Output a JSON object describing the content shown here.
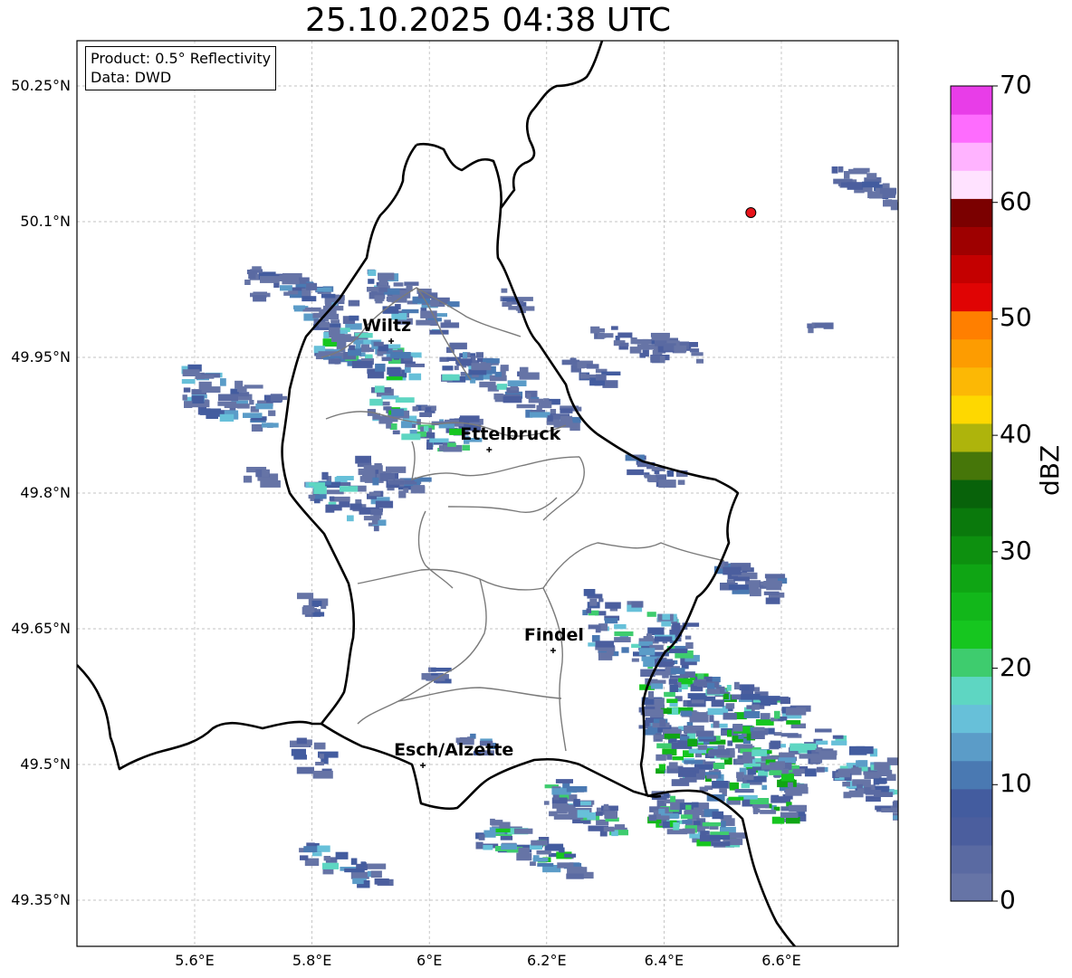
{
  "title": "25.10.2025 04:38 UTC",
  "info": {
    "product": "Product: 0.5° Reflectivity",
    "data": "Data: DWD"
  },
  "lat_labels": [
    "50.25°N",
    "50.1°N",
    "49.95°N",
    "49.8°N",
    "49.65°N",
    "49.5°N",
    "49.35°N"
  ],
  "lon_labels": [
    "5.6°E",
    "5.8°E",
    "6°E",
    "6.2°E",
    "6.4°E",
    "6.6°E"
  ],
  "cities": [
    {
      "name": "Wiltz",
      "lon": 5.935,
      "lat": 49.968
    },
    {
      "name": "Ettelbruck",
      "lon": 6.102,
      "lat": 49.848
    },
    {
      "name": "Findel",
      "lon": 6.211,
      "lat": 49.626
    },
    {
      "name": "Esch/Alzette",
      "lon": 5.989,
      "lat": 49.499
    }
  ],
  "radar_site": {
    "lon": 6.548,
    "lat": 50.11,
    "color": "#e8141b"
  },
  "colorbar": {
    "label": "dBZ",
    "ticks": [
      "0",
      "10",
      "20",
      "30",
      "40",
      "50",
      "60",
      "70"
    ],
    "colors": [
      "#6674a6",
      "#5a6aa2",
      "#4b5e9e",
      "#435c9f",
      "#4a79b2",
      "#5b9cc8",
      "#67c0d9",
      "#5ed6c2",
      "#3ecc6e",
      "#16c61f",
      "#12b71a",
      "#0fa514",
      "#0d900f",
      "#0a790c",
      "#08620a",
      "#467609",
      "#aeb40c",
      "#fed800",
      "#fcb805",
      "#fd9c01",
      "#ff7f00",
      "#e00404",
      "#c40000",
      "#9e0000",
      "#7b0000",
      "#ffe2ff",
      "#ffb3ff",
      "#fe6cfe",
      "#e83de8"
    ]
  }
}
